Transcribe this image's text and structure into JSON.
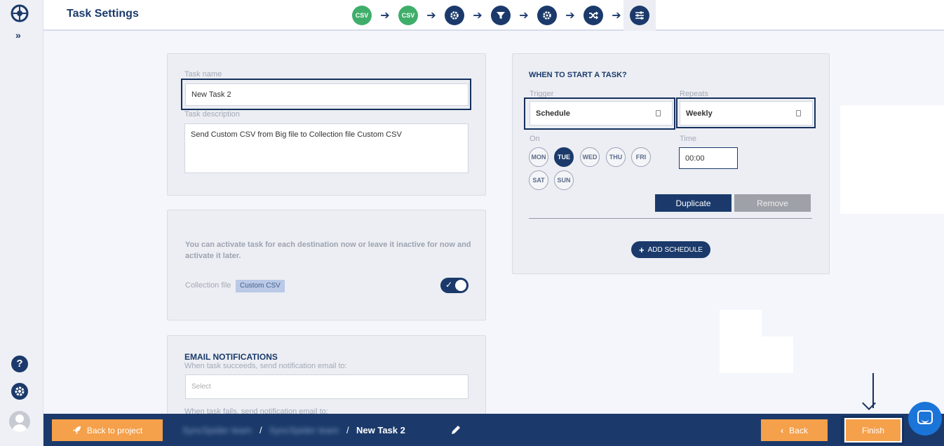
{
  "header": {
    "title": "Task Settings",
    "steps": [
      {
        "label": "CSV",
        "icon": "csv-icon",
        "kind": "csv"
      },
      {
        "label": "CSV",
        "icon": "csv-icon",
        "kind": "csv"
      },
      {
        "label": "",
        "icon": "gear-icon",
        "kind": "settings"
      },
      {
        "label": "",
        "icon": "filter-icon",
        "kind": "filter"
      },
      {
        "label": "",
        "icon": "gear-icon",
        "kind": "settings"
      },
      {
        "label": "",
        "icon": "shuffle-icon",
        "kind": "mapping"
      },
      {
        "label": "",
        "icon": "sliders-icon",
        "kind": "task-settings"
      }
    ]
  },
  "task": {
    "name_label": "Task name",
    "name_value": "New Task 2",
    "description_label": "Task description",
    "description_value": "Send Custom CSV from Big file to Collection file Custom CSV"
  },
  "activation": {
    "text": "You can activate task for each destination now or leave it inactive for now and activate it later.",
    "collection_label": "Collection file",
    "collection_tag": "Custom CSV",
    "active": true
  },
  "email": {
    "title": "EMAIL NOTIFICATIONS",
    "success_label": "When task succeeds, send notification email to:",
    "select_placeholder": "Select",
    "fail_label": "When task fails, send notification email to:"
  },
  "schedule": {
    "title": "WHEN TO START A TASK?",
    "trigger_label": "Trigger",
    "trigger_value": "Schedule",
    "repeats_label": "Repeats",
    "repeats_value": "Weekly",
    "on_label": "On",
    "time_label": "Time",
    "time_value": "00:00",
    "days": [
      {
        "label": "MON",
        "active": false
      },
      {
        "label": "TUE",
        "active": true
      },
      {
        "label": "WED",
        "active": false
      },
      {
        "label": "THU",
        "active": false
      },
      {
        "label": "FRI",
        "active": false
      },
      {
        "label": "SAT",
        "active": false
      },
      {
        "label": "SUN",
        "active": false
      }
    ],
    "duplicate_label": "Duplicate",
    "remove_label": "Remove",
    "add_label": "ADD SCHEDULE"
  },
  "footer": {
    "back_to_project_label": "Back to project",
    "crumb_1": "SyncSpider team",
    "crumb_2": "SyncSpider team",
    "crumb_sep": "/",
    "crumb_current": "New Task 2",
    "back_label": "Back",
    "finish_label": "Finish"
  },
  "colors": {
    "primary": "#1b3a6b",
    "accent": "#f5a04a",
    "csv_green": "#3fae6a"
  }
}
